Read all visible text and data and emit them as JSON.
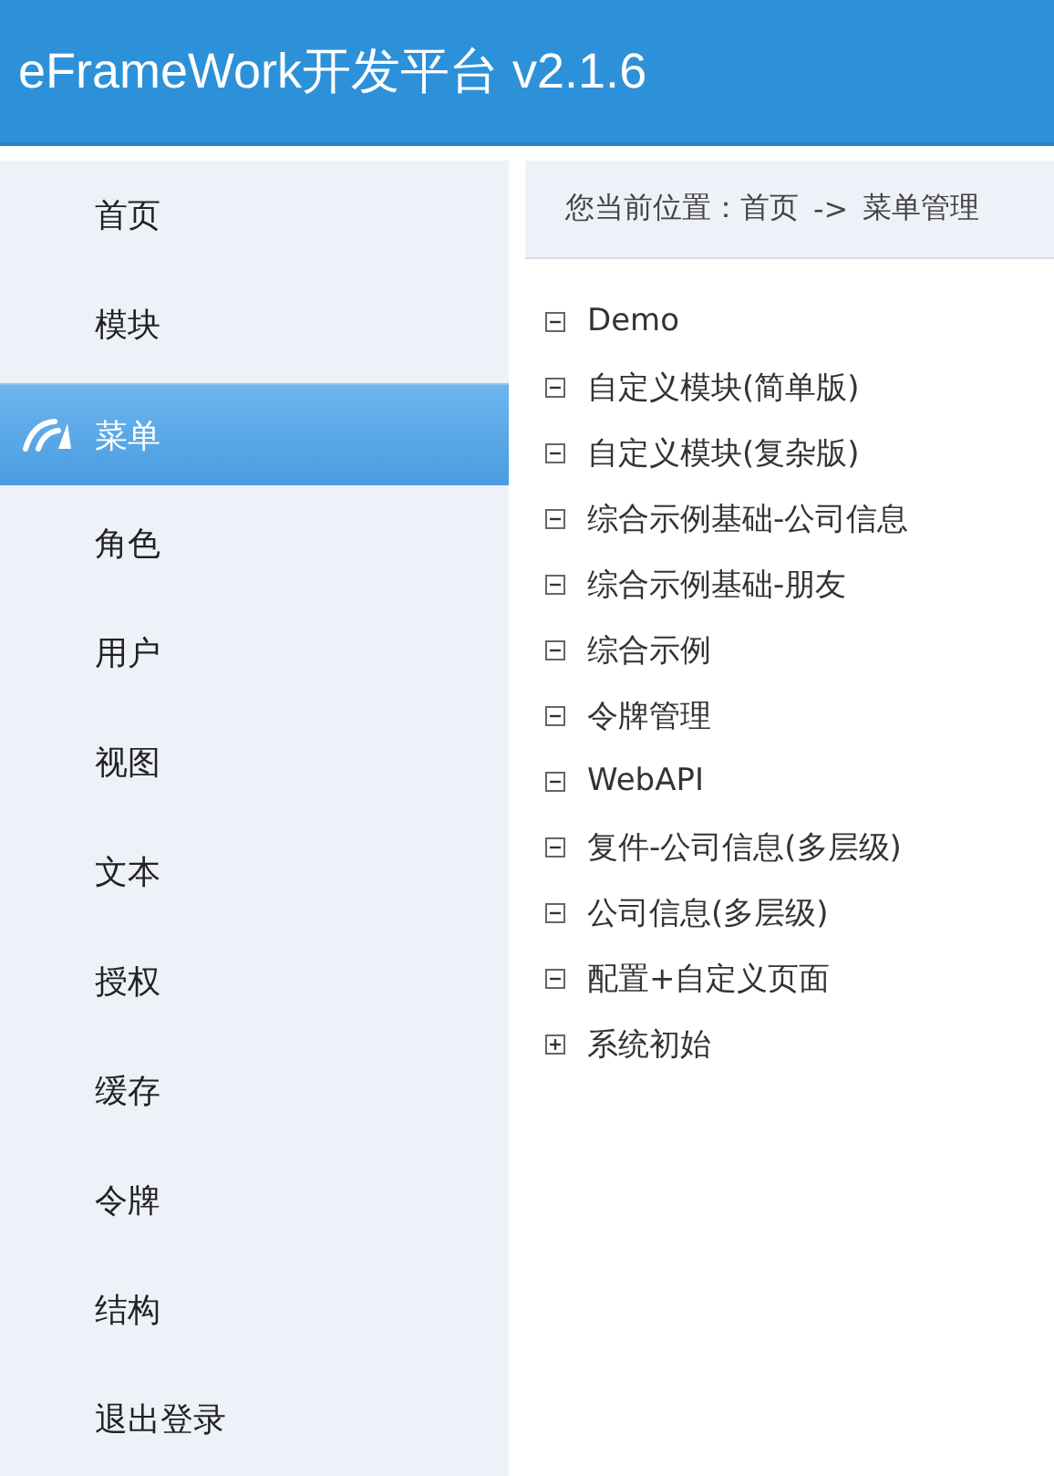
{
  "header": {
    "title": "eFrameWork开发平台 v2.1.6"
  },
  "sidebar": {
    "items": [
      {
        "label": "首页",
        "selected": false
      },
      {
        "label": "模块",
        "selected": false
      },
      {
        "label": "菜单",
        "selected": true
      },
      {
        "label": "角色",
        "selected": false
      },
      {
        "label": "用户",
        "selected": false
      },
      {
        "label": "视图",
        "selected": false
      },
      {
        "label": "文本",
        "selected": false
      },
      {
        "label": "授权",
        "selected": false
      },
      {
        "label": "缓存",
        "selected": false
      },
      {
        "label": "令牌",
        "selected": false
      },
      {
        "label": "结构",
        "selected": false
      },
      {
        "label": "退出登录",
        "selected": false
      }
    ]
  },
  "breadcrumb": {
    "prefix": "您当前位置：",
    "items": [
      "首页",
      "菜单管理"
    ],
    "separator": "->"
  },
  "tree": [
    {
      "label": "Demo",
      "expanded": true
    },
    {
      "label": "自定义模块(简单版)",
      "expanded": true
    },
    {
      "label": "自定义模块(复杂版)",
      "expanded": true
    },
    {
      "label": "综合示例基础-公司信息",
      "expanded": true
    },
    {
      "label": "综合示例基础-朋友",
      "expanded": true
    },
    {
      "label": "综合示例",
      "expanded": true
    },
    {
      "label": "令牌管理",
      "expanded": true
    },
    {
      "label": "WebAPI",
      "expanded": true
    },
    {
      "label": "复件-公司信息(多层级)",
      "expanded": true
    },
    {
      "label": "公司信息(多层级)",
      "expanded": true
    },
    {
      "label": "配置+自定义页面",
      "expanded": true
    },
    {
      "label": "系统初始",
      "expanded": false
    }
  ]
}
